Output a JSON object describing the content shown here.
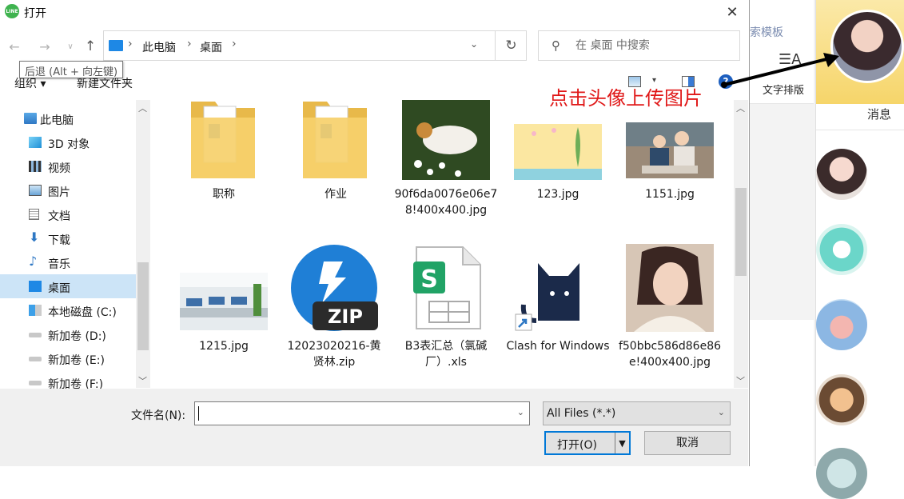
{
  "dialog": {
    "title": "打开",
    "app_badge": "LINE",
    "close": "✕"
  },
  "navigation": {
    "back": "←",
    "forward": "→",
    "recent": "∨",
    "up": "↑",
    "tooltip": "后退 (Alt + 向左键)",
    "breadcrumb": [
      "此电脑",
      "桌面"
    ],
    "refresh": "↻",
    "search_placeholder": "在 桌面 中搜索"
  },
  "toolbar": {
    "organize": "组织 ▾",
    "new_folder": "新建文件夹",
    "help": "?"
  },
  "annotation": {
    "text": "点击头像上传图片"
  },
  "nav_pane": {
    "items": [
      {
        "label": "此电脑",
        "icon": "computer-icon"
      },
      {
        "label": "3D 对象",
        "icon": "cube-icon"
      },
      {
        "label": "视频",
        "icon": "video-icon"
      },
      {
        "label": "图片",
        "icon": "picture-icon"
      },
      {
        "label": "文档",
        "icon": "document-icon"
      },
      {
        "label": "下载",
        "icon": "download-icon"
      },
      {
        "label": "音乐",
        "icon": "music-icon"
      },
      {
        "label": "桌面",
        "icon": "desktop-icon",
        "selected": true
      },
      {
        "label": "本地磁盘 (C:)",
        "icon": "windows-drive-icon"
      },
      {
        "label": "新加卷 (D:)",
        "icon": "drive-icon"
      },
      {
        "label": "新加卷 (E:)",
        "icon": "drive-icon"
      },
      {
        "label": "新加卷 (F:)",
        "icon": "drive-icon"
      }
    ]
  },
  "files": [
    {
      "name": "职称",
      "kind": "folder"
    },
    {
      "name": "作业",
      "kind": "folder"
    },
    {
      "name": "90f6da0076e06e78!400x400.jpg",
      "kind": "image-cat"
    },
    {
      "name": "123.jpg",
      "kind": "image-yellow"
    },
    {
      "name": "1151.jpg",
      "kind": "image-family"
    },
    {
      "name": "1215.jpg",
      "kind": "image-office"
    },
    {
      "name": "12023020216-黄贤林.zip",
      "kind": "zip"
    },
    {
      "name": "B3表汇总（氯碱厂）.xls",
      "kind": "xls"
    },
    {
      "name": "Clash for Windows",
      "kind": "shortcut"
    },
    {
      "name": "f50bbc586d86e86e!400x400.jpg",
      "kind": "image-girl"
    }
  ],
  "bottom": {
    "filename_label": "文件名(N):",
    "filename_value": "",
    "filetype": "All Files (*.*)",
    "open": "打开(O)",
    "cancel": "取消",
    "zip_badge": "ZIP",
    "xls_badge": "S"
  },
  "background_app": {
    "template_text": "索模板",
    "text_layout_icon": "☰A",
    "text_layout": "文字排版",
    "messages": "消息"
  }
}
